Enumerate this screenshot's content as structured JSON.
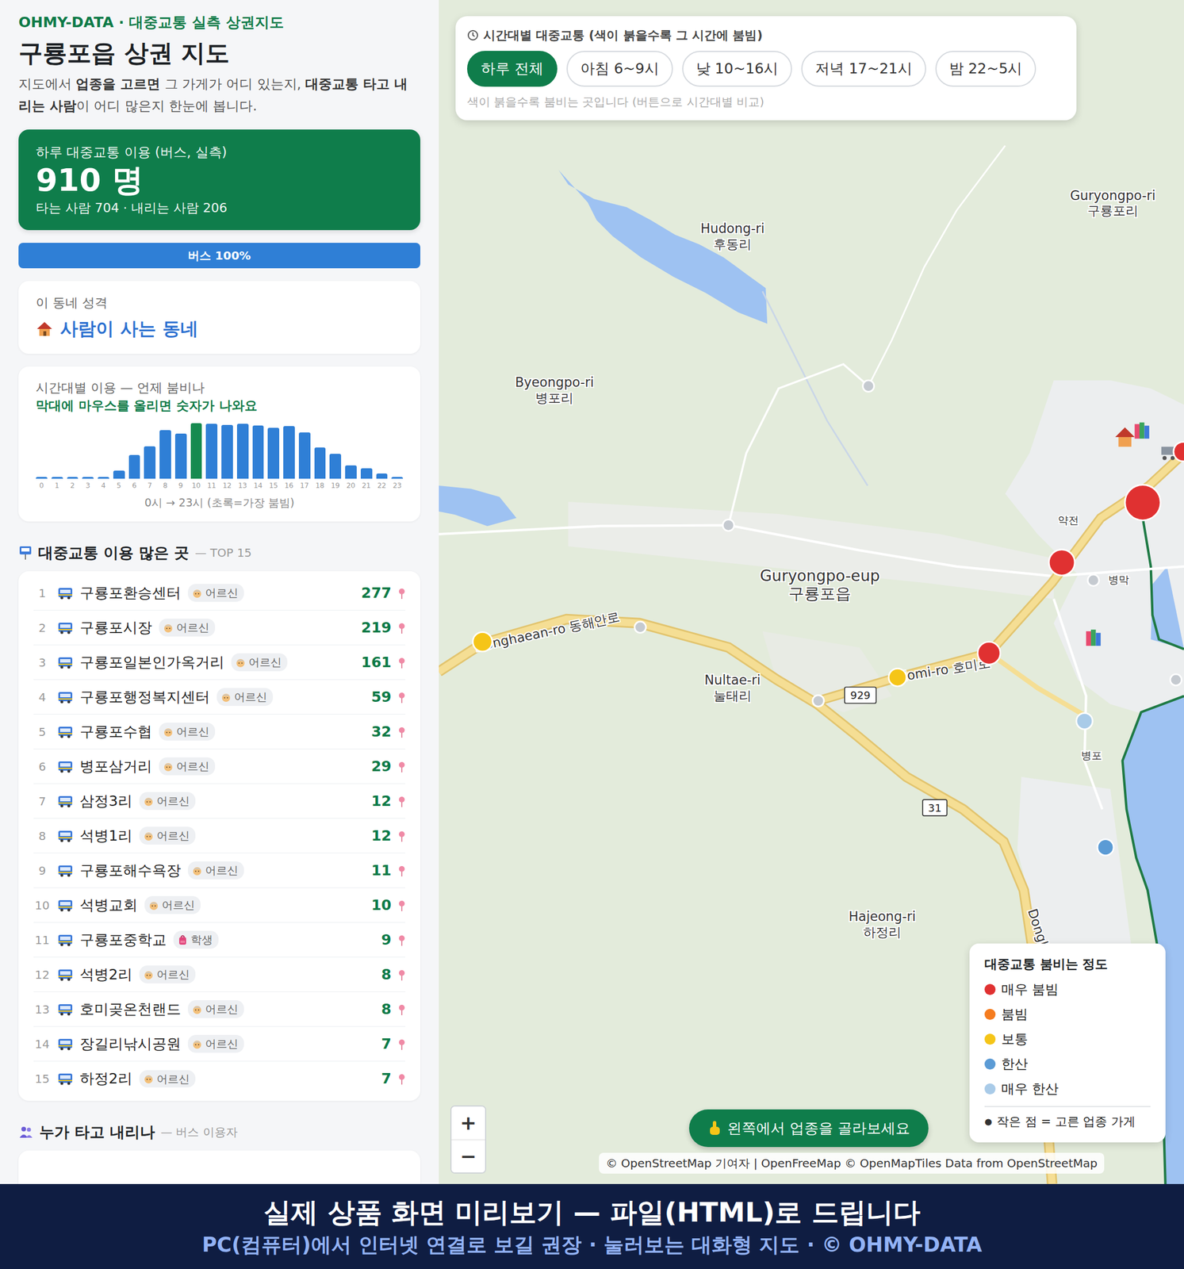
{
  "brand": "OHMY-DATA · 대중교통 실측 상권지도",
  "title": "구룡포읍 상권 지도",
  "intro": [
    {
      "text": "지도에서 ",
      "bold": false
    },
    {
      "text": "업종을 고르면",
      "bold": true
    },
    {
      "text": " 그 가게가 어디 있는지, ",
      "bold": false
    },
    {
      "text": "대중교통 타고 내리는 사람",
      "bold": true
    },
    {
      "text": "이 어디 많은지 한눈에 봅니다.",
      "bold": false
    }
  ],
  "summary": {
    "label": "하루 대중교통 이용 (버스, 실측)",
    "value": "910 명",
    "detail": "타는 사람 704 · 내리는 사람 206"
  },
  "modes": [
    {
      "label": "버스 100%",
      "level": 1,
      "color": "#2f7fd6"
    }
  ],
  "character": {
    "label": "이 동네 성격",
    "value": "사람이 사는 동네"
  },
  "hourly": {
    "title": "시간대별 이용 — 언제 붐비나",
    "hint": "막대에 마우스를 올리면 숫자가 나와요",
    "values": [
      1,
      1,
      1,
      1,
      1,
      11,
      32,
      43,
      65,
      60,
      74,
      73,
      72,
      73,
      71,
      68,
      70,
      62,
      42,
      33,
      18,
      14,
      7,
      2
    ],
    "ticks": [
      "0",
      "1",
      "2",
      "3",
      "4",
      "5",
      "6",
      "7",
      "8",
      "9",
      "10",
      "11",
      "12",
      "13",
      "14",
      "15",
      "16",
      "17",
      "18",
      "19",
      "20",
      "21",
      "22",
      "23"
    ],
    "peak_index": 10,
    "caption": "0시 → 23시 (초록=가장 붐빔)"
  },
  "top": {
    "title": "대중교통 이용 많은 곳",
    "sub": "— TOP 15",
    "items": [
      {
        "rank": "1",
        "name": "구룡포환승센터",
        "tag": "어르신",
        "kind": "elder",
        "count": "277"
      },
      {
        "rank": "2",
        "name": "구룡포시장",
        "tag": "어르신",
        "kind": "elder",
        "count": "219"
      },
      {
        "rank": "3",
        "name": "구룡포일본인가옥거리",
        "tag": "어르신",
        "kind": "elder",
        "count": "161"
      },
      {
        "rank": "4",
        "name": "구룡포행정복지센터",
        "tag": "어르신",
        "kind": "elder",
        "count": "59"
      },
      {
        "rank": "5",
        "name": "구룡포수협",
        "tag": "어르신",
        "kind": "elder",
        "count": "32"
      },
      {
        "rank": "6",
        "name": "병포삼거리",
        "tag": "어르신",
        "kind": "elder",
        "count": "29"
      },
      {
        "rank": "7",
        "name": "삼정3리",
        "tag": "어르신",
        "kind": "elder",
        "count": "12"
      },
      {
        "rank": "8",
        "name": "석병1리",
        "tag": "어르신",
        "kind": "elder",
        "count": "12"
      },
      {
        "rank": "9",
        "name": "구룡포해수욕장",
        "tag": "어르신",
        "kind": "elder",
        "count": "11"
      },
      {
        "rank": "10",
        "name": "석병교회",
        "tag": "어르신",
        "kind": "elder",
        "count": "10"
      },
      {
        "rank": "11",
        "name": "구룡포중학교",
        "tag": "학생",
        "kind": "student",
        "count": "9"
      },
      {
        "rank": "12",
        "name": "석병2리",
        "tag": "어르신",
        "kind": "elder",
        "count": "8"
      },
      {
        "rank": "13",
        "name": "호미곶온천랜드",
        "tag": "어르신",
        "kind": "elder",
        "count": "8"
      },
      {
        "rank": "14",
        "name": "장길리낚시공원",
        "tag": "어르신",
        "kind": "elder",
        "count": "7"
      },
      {
        "rank": "15",
        "name": "하정2리",
        "tag": "어르신",
        "kind": "elder",
        "count": "7"
      }
    ]
  },
  "riders": {
    "title": "누가 타고 내리나",
    "sub": "— 버스 이용자"
  },
  "map": {
    "filter": {
      "title": "시간대별 대중교통 (색이 붉을수록 그 시간에 붐빔)",
      "buttons": [
        {
          "label": "하루 전체",
          "selected": true
        },
        {
          "label": "아침 6~9시",
          "selected": false
        },
        {
          "label": "낮 10~16시",
          "selected": false
        },
        {
          "label": "저녁 17~21시",
          "selected": false
        },
        {
          "label": "밤 22~5시",
          "selected": false
        }
      ],
      "hint": "색이 붉을수록 붐비는 곳입니다 (버튼으로 시간대별 비교)"
    },
    "places": [
      {
        "en": "Hudong-ri",
        "ko": "후동리"
      },
      {
        "en": "Byeongpo-ri",
        "ko": "병포리"
      },
      {
        "en": "Guryongpo-eup",
        "ko": "구룡포읍"
      },
      {
        "en": "Nultae-ri",
        "ko": "눌태리"
      },
      {
        "en": "Hajeong-ri",
        "ko": "하정리"
      },
      {
        "en": "Guryongpo-ri",
        "ko": "구룡포리"
      }
    ],
    "small_labels": [
      "약전",
      "병막",
      "병포"
    ],
    "roads": [
      "Donghaean-ro 동해안로",
      "Homi-ro 호미로",
      "Dongh"
    ],
    "shields": [
      "929",
      "31"
    ],
    "stops": [
      {
        "color": "#e03131"
      },
      {
        "color": "#e03131"
      },
      {
        "color": "#e03131"
      },
      {
        "color": "#e03131"
      },
      {
        "color": "#f5c518"
      },
      {
        "color": "#f5c518"
      },
      {
        "color": "#a9cbe8"
      },
      {
        "color": "#5b9bd5"
      },
      {
        "color": "#5b9bd5"
      },
      {
        "color": "#c5cad0"
      },
      {
        "color": "#c5cad0"
      },
      {
        "color": "#c5cad0"
      },
      {
        "color": "#c5cad0"
      },
      {
        "color": "#c5cad0"
      },
      {
        "color": "#c5cad0"
      }
    ],
    "legend": {
      "title": "대중교통 붐비는 정도",
      "items": [
        {
          "label": "매우 붐빔",
          "color": "#e03131"
        },
        {
          "label": "붐빔",
          "color": "#f57c1f"
        },
        {
          "label": "보통",
          "color": "#f5c518"
        },
        {
          "label": "한산",
          "color": "#5b9bd5"
        },
        {
          "label": "매우 한산",
          "color": "#a9cbe8"
        }
      ],
      "note_icon": "●",
      "note": "작은 점 = 고른 업종 가게"
    },
    "zoom": [
      "+",
      "−"
    ],
    "cta": "왼쪽에서 업종을 골라보세요",
    "attribution": "© OpenStreetMap 기여자 | OpenFreeMap © OpenMapTiles Data from OpenStreetMap"
  },
  "banner": {
    "line1": "실제 상품 화면 미리보기 — 파일(HTML)로 드립니다",
    "line2": "PC(컴퓨터)에서 인터넷 연결로 보길 권장 · 눌러보는 대화형 지도 · © OHMY-DATA"
  }
}
